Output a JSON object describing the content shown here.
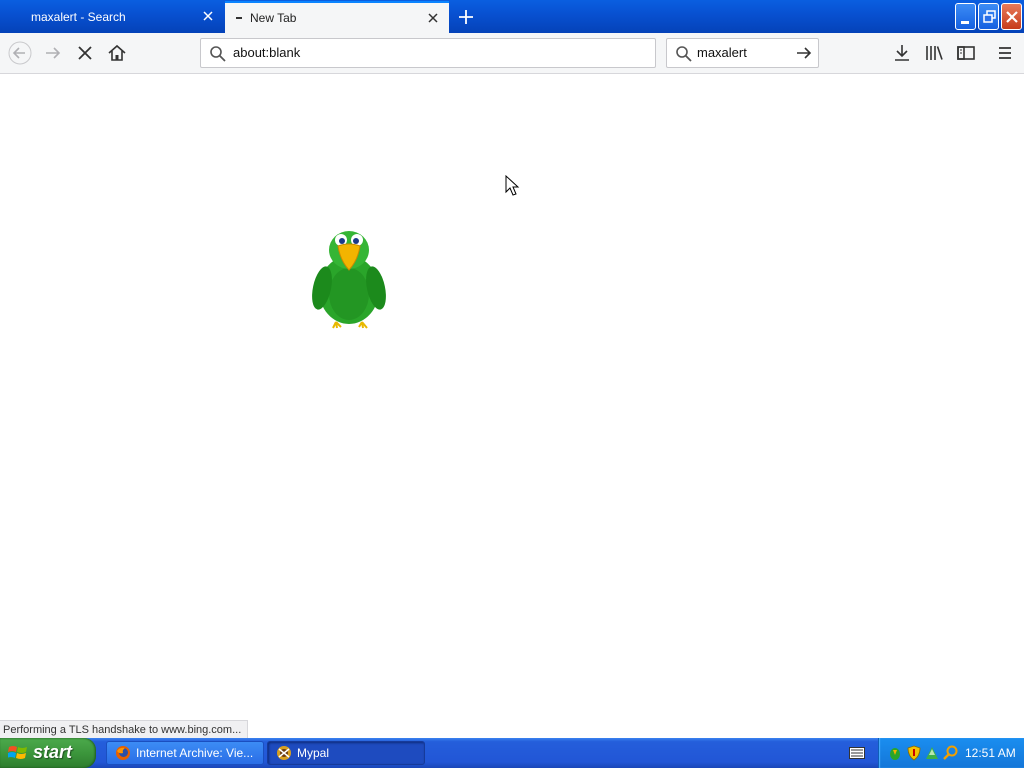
{
  "browser": {
    "tabs": [
      {
        "title": "maxalert - Search",
        "active": false
      },
      {
        "title": "New Tab",
        "active": true
      }
    ],
    "url": "about:blank",
    "search": {
      "value": "maxalert"
    },
    "status_text": "Performing a TLS handshake to www.bing.com...",
    "accent_color": "#0a84ff"
  },
  "page": {
    "character": "green-parrot"
  },
  "taskbar": {
    "start_label": "start",
    "tasks": [
      {
        "label": "Internet Archive: Vie...",
        "icon": "firefox-icon",
        "active": false
      },
      {
        "label": "Mypal",
        "icon": "mypal-icon",
        "active": true
      }
    ],
    "tray_icons": [
      "bonzi-tray-icon",
      "security-shield-icon",
      "network-icon",
      "search-tray-icon"
    ],
    "clock": "12:51 AM"
  }
}
